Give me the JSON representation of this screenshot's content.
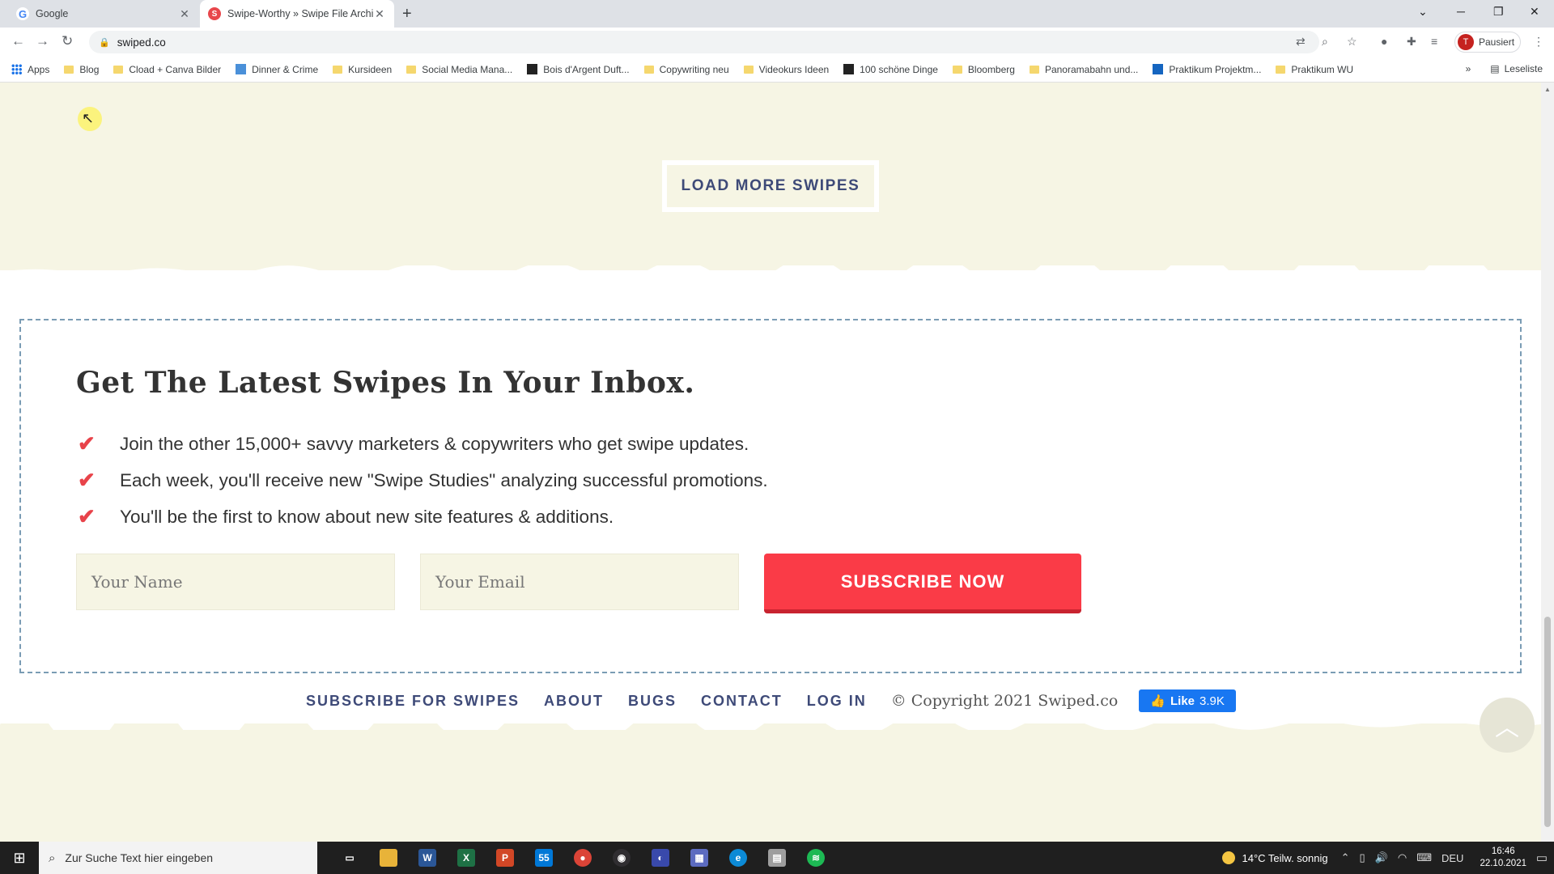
{
  "browser": {
    "tabs": [
      {
        "title": "Google",
        "active": false
      },
      {
        "title": "Swipe-Worthy » Swipe File Archi",
        "active": true
      }
    ],
    "url": "swiped.co",
    "profile_label": "Pausiert",
    "profile_initial": "T",
    "bookmarks": [
      {
        "label": "Apps",
        "icon": "apps-grid-icon"
      },
      {
        "label": "Blog",
        "icon": "folder-icon"
      },
      {
        "label": "Cload + Canva Bilder",
        "icon": "folder-icon"
      },
      {
        "label": "Dinner & Crime",
        "icon": "site-icon"
      },
      {
        "label": "Kursideen",
        "icon": "folder-icon"
      },
      {
        "label": "Social Media Mana...",
        "icon": "folder-icon"
      },
      {
        "label": "Bois d'Argent Duft...",
        "icon": "site-icon"
      },
      {
        "label": "Copywriting neu",
        "icon": "folder-icon"
      },
      {
        "label": "Videokurs Ideen",
        "icon": "folder-icon"
      },
      {
        "label": "100 schöne Dinge",
        "icon": "site-icon"
      },
      {
        "label": "Bloomberg",
        "icon": "folder-icon"
      },
      {
        "label": "Panoramabahn und...",
        "icon": "folder-icon"
      },
      {
        "label": "Praktikum Projektm...",
        "icon": "site-icon"
      },
      {
        "label": "Praktikum WU",
        "icon": "folder-icon"
      }
    ],
    "overflow_label": "»",
    "reading_list_label": "Leseliste"
  },
  "page": {
    "load_more_label": "LOAD MORE SWIPES",
    "signup": {
      "heading": "Get The Latest Swipes In Your Inbox.",
      "benefits": [
        "Join the other 15,000+ savvy marketers & copywriters who get swipe updates.",
        "Each week, you'll receive new \"Swipe Studies\" analyzing successful promotions.",
        "You'll be the first to know about new site features & additions."
      ],
      "name_placeholder": "Your Name",
      "email_placeholder": "Your Email",
      "subscribe_label": "SUBSCRIBE NOW"
    },
    "footer": {
      "links": [
        "SUBSCRIBE FOR SWIPES",
        "ABOUT",
        "BUGS",
        "CONTACT",
        "LOG IN"
      ],
      "copyright": "© Copyright 2021 Swiped.co",
      "fb_like_label": "Like",
      "fb_like_count": "3.9K"
    }
  },
  "taskbar": {
    "search_placeholder": "Zur Suche Text hier eingeben",
    "mail_badge": "55",
    "weather": "14°C  Teilw. sonnig",
    "language": "DEU",
    "time": "16:46",
    "date": "22.10.2021"
  },
  "colors": {
    "page_bg": "#f6f5e4",
    "accent_red": "#fa3b47",
    "nav_blue": "#3e4a78",
    "dashed_border": "#7a9cb4"
  }
}
